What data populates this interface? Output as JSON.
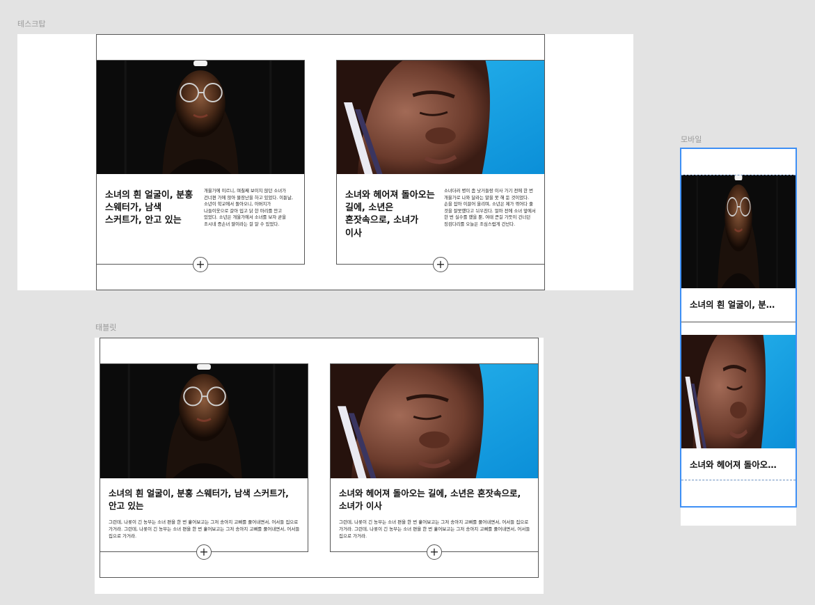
{
  "frames": {
    "desktop": {
      "label": "테스크탑"
    },
    "tablet": {
      "label": "태블릿"
    },
    "mobile": {
      "label": "모바일"
    }
  },
  "cards": [
    {
      "photo_icon": "portrait-glasses-dark",
      "title": "소녀의 흰 얼굴이, 분홍 스웨터가, 남색 스커트가, 안고 있는",
      "desktop_body": "개울가에 이르니, 며칠째 보이지 않던 소녀가 건너편 가에 앉아 물장난을 하고 있었다. 이튿날, 소년이 학교에서 돌아오니, 아버지가 나들이옷으로 갈아 입고 닭 한 마리를 안고 있었다. 소년은 개울가에서 소녀를 보자 곧을 조시네 증손녀 딸이라는 걸 알 수 있었다.",
      "tablet_body": "그런데, 나롯이 긴 농부는 소녀 편을 한 번 훑어보고는 그저 송아지 고삐를 풀어내면서, 어서들 집으로 가거라. 그런데, 나롯이 긴 농부는 소녀 편을 한 번 훑어보고는 그저 송아지 고삐를 풀어내면서, 어서들 집으로 가거라.",
      "mobile_title": "소녀의 흰 얼굴이, 분…"
    },
    {
      "photo_icon": "portrait-blue-background",
      "title": "소녀와 헤어져 돌아오는 길에, 소년은 혼잣속으로, 소녀가 이사",
      "desktop_body": "소녀더러 병이 좀 낫거들랑 이사 가기 전에 한 번 개울가로 나와 달라는 말을 못 해 둔 것이었다. 손을 잡아 이끌어 올리며, 소년은 제가 꺾어다 줄 것을 잘못했다고 뉘우친다. 얼마 전에 소녀 앞에서 한 번 실수를 했을 뿐, 여태 큰길 가듯이 건너던 징검다리를 오늘은 조심스럽게 건넌다.",
      "tablet_body": "그런데, 나롯이 긴 농부는 소녀 편을 한 번 훑어보고는 그저 송아지 고삐를 풀어내면서, 어서들 집으로 가거라. 그런데, 나롯이 긴 농부는 소녀 편을 한 번 훑어보고는 그저 송아지 고삐를 풀어내면서, 어서들 집으로 가거라.",
      "mobile_title": "소녀와 헤어져 돌아오…"
    }
  ],
  "add_button": {
    "label": "+",
    "icon": "plus-circle-icon"
  },
  "colors": {
    "canvas": "#e3e3e3",
    "selection": "#3d8ff5",
    "border": "#555555",
    "photo1_bg": "#0b0b0b",
    "photo2_bg": "#1aa7e6"
  }
}
